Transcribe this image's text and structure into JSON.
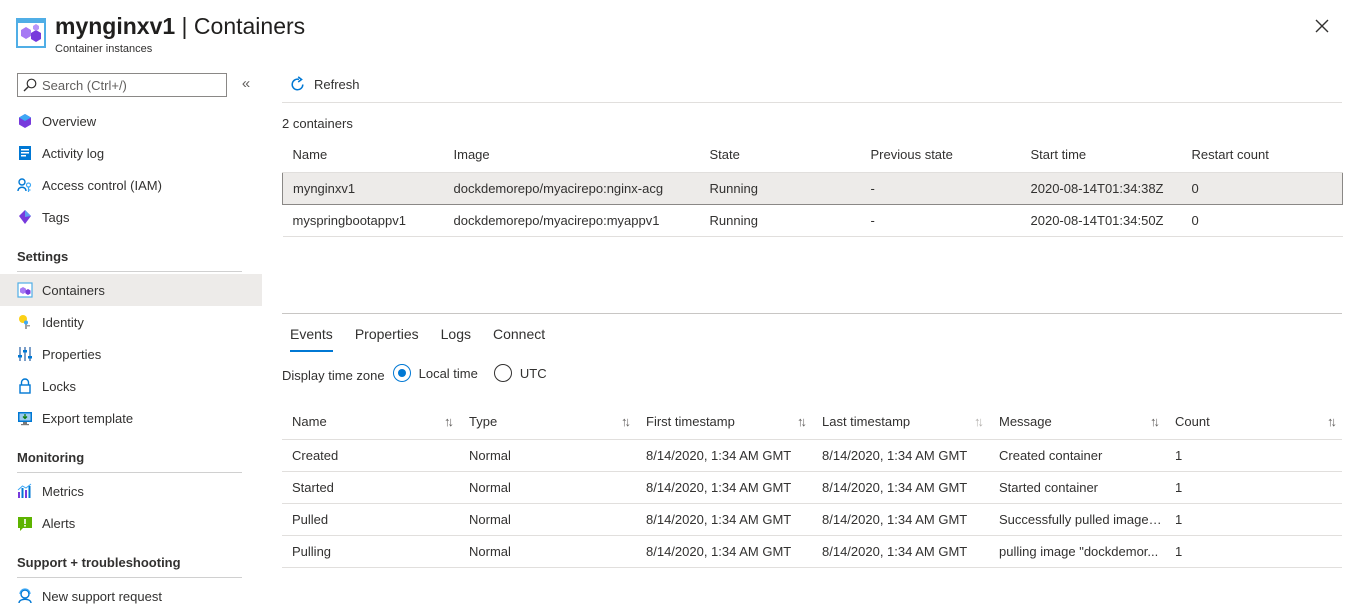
{
  "header": {
    "resource_name": "mynginxv1",
    "separator": " | ",
    "page": "Containers",
    "subtitle": "Container instances",
    "accent": "#0078d4"
  },
  "sidebar": {
    "search_placeholder": "Search (Ctrl+/)",
    "collapse_glyph": "«",
    "items": [
      {
        "label": "Overview",
        "icon": "overview-icon"
      },
      {
        "label": "Activity log",
        "icon": "activity-log-icon"
      },
      {
        "label": "Access control (IAM)",
        "icon": "iam-icon"
      },
      {
        "label": "Tags",
        "icon": "tag-icon"
      }
    ],
    "sections": [
      {
        "title": "Settings",
        "items": [
          {
            "label": "Containers",
            "icon": "containers-icon",
            "active": true
          },
          {
            "label": "Identity",
            "icon": "identity-icon"
          },
          {
            "label": "Properties",
            "icon": "properties-icon"
          },
          {
            "label": "Locks",
            "icon": "lock-icon"
          },
          {
            "label": "Export template",
            "icon": "export-template-icon"
          }
        ]
      },
      {
        "title": "Monitoring",
        "items": [
          {
            "label": "Metrics",
            "icon": "metrics-icon"
          },
          {
            "label": "Alerts",
            "icon": "alerts-icon"
          }
        ]
      },
      {
        "title": "Support + troubleshooting",
        "items": [
          {
            "label": "New support request",
            "icon": "support-icon"
          }
        ]
      }
    ]
  },
  "toolbar": {
    "refresh_label": "Refresh"
  },
  "containers": {
    "count_label": "2 containers",
    "columns": [
      "Name",
      "Image",
      "State",
      "Previous state",
      "Start time",
      "Restart count"
    ],
    "rows": [
      {
        "name": "mynginxv1",
        "image": "dockdemorepo/myacirepo:nginx-acg",
        "state": "Running",
        "previous_state": "-",
        "start_time": "2020-08-14T01:34:38Z",
        "restart_count": "0",
        "selected": true
      },
      {
        "name": "myspringbootappv1",
        "image": "dockdemorepo/myacirepo:myappv1",
        "state": "Running",
        "previous_state": "-",
        "start_time": "2020-08-14T01:34:50Z",
        "restart_count": "0",
        "selected": false
      }
    ]
  },
  "tabs": [
    {
      "label": "Events",
      "active": true
    },
    {
      "label": "Properties",
      "active": false
    },
    {
      "label": "Logs",
      "active": false
    },
    {
      "label": "Connect",
      "active": false
    }
  ],
  "timezone": {
    "label": "Display time zone",
    "options": [
      {
        "label": "Local time",
        "checked": true
      },
      {
        "label": "UTC",
        "checked": false
      }
    ]
  },
  "events": {
    "columns": [
      "Name",
      "Type",
      "First timestamp",
      "Last timestamp",
      "Message",
      "Count"
    ],
    "sort_glyph": "↑↓",
    "rows": [
      {
        "name": "Created",
        "type": "Normal",
        "first": "8/14/2020, 1:34 AM GMT",
        "last": "8/14/2020, 1:34 AM GMT",
        "message": "Created container",
        "count": "1"
      },
      {
        "name": "Started",
        "type": "Normal",
        "first": "8/14/2020, 1:34 AM GMT",
        "last": "8/14/2020, 1:34 AM GMT",
        "message": "Started container",
        "count": "1"
      },
      {
        "name": "Pulled",
        "type": "Normal",
        "first": "8/14/2020, 1:34 AM GMT",
        "last": "8/14/2020, 1:34 AM GMT",
        "message": "Successfully pulled image \"...",
        "count": "1"
      },
      {
        "name": "Pulling",
        "type": "Normal",
        "first": "8/14/2020, 1:34 AM GMT",
        "last": "8/14/2020, 1:34 AM GMT",
        "message": "pulling image \"dockdemor...",
        "count": "1"
      }
    ]
  }
}
